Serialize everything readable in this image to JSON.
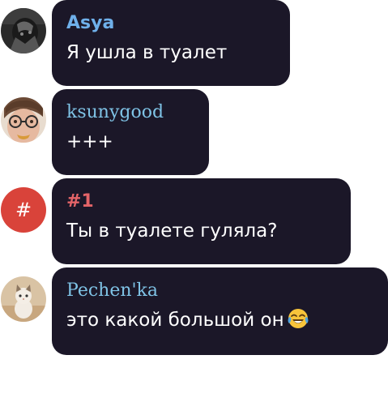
{
  "messages": [
    {
      "author": "Asya",
      "text": "Я ушла в туалет",
      "name_color": "#6fb0ea",
      "avatar_icon": "dark-photo-avatar"
    },
    {
      "author": "ksunygood",
      "text": "+++",
      "name_color": "#7fc3e6",
      "avatar_icon": "girl-glasses-avatar"
    },
    {
      "author": "#1",
      "text": "Ты в туалете гуляла?",
      "name_color": "#e36468",
      "avatar_icon": "hash-avatar",
      "avatar_label": "#"
    },
    {
      "author": "Pechen'ka",
      "text": "это какой большой он",
      "name_color": "#7fc3e6",
      "avatar_icon": "kitten-avatar",
      "emoji": "face-with-tears-of-joy"
    }
  ],
  "bubble_color": "#1b1728"
}
